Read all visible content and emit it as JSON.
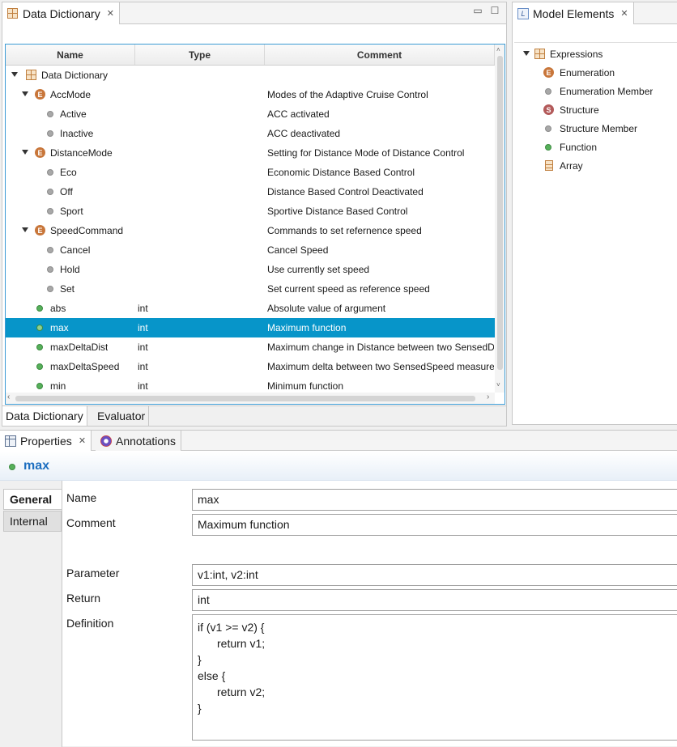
{
  "data_dictionary_view": {
    "tab_title": "Data Dictionary",
    "columns": [
      "Name",
      "Type",
      "Comment"
    ],
    "rows": [
      {
        "name": "Data Dictionary",
        "type": "",
        "comment": ""
      },
      {
        "name": "AccMode",
        "type": "",
        "comment": "Modes of the Adaptive Cruise Control"
      },
      {
        "name": "Active",
        "type": "",
        "comment": "ACC activated"
      },
      {
        "name": "Inactive",
        "type": "",
        "comment": "ACC deactivated"
      },
      {
        "name": "DistanceMode",
        "type": "",
        "comment": "Setting for Distance Mode of Distance Control"
      },
      {
        "name": "Eco",
        "type": "",
        "comment": "Economic Distance Based Control"
      },
      {
        "name": "Off",
        "type": "",
        "comment": "Distance Based Control Deactivated"
      },
      {
        "name": "Sport",
        "type": "",
        "comment": "Sportive Distance Based Control"
      },
      {
        "name": "SpeedCommand",
        "type": "",
        "comment": "Commands to set refernence speed"
      },
      {
        "name": "Cancel",
        "type": "",
        "comment": "Cancel Speed"
      },
      {
        "name": "Hold",
        "type": "",
        "comment": "Use currently set speed"
      },
      {
        "name": "Set",
        "type": "",
        "comment": "Set current speed as reference speed"
      },
      {
        "name": "abs",
        "type": "int",
        "comment": "Absolute value of argument"
      },
      {
        "name": "max",
        "type": "int",
        "comment": "Maximum function"
      },
      {
        "name": "maxDeltaDist",
        "type": "int",
        "comment": "Maximum change in Distance between two SensedDi..."
      },
      {
        "name": "maxDeltaSpeed",
        "type": "int",
        "comment": "Maximum delta between two SensedSpeed measure..."
      },
      {
        "name": "min",
        "type": "int",
        "comment": "Minimum function"
      }
    ],
    "bottom_tabs": [
      "Data Dictionary",
      "Evaluator"
    ]
  },
  "model_elements_view": {
    "tab_title": "Model Elements",
    "items": [
      {
        "label": "Expressions",
        "icon": "table-icon"
      },
      {
        "label": "Enumeration",
        "icon": "enumeration-icon"
      },
      {
        "label": "Enumeration Member",
        "icon": "member-icon"
      },
      {
        "label": "Structure",
        "icon": "structure-icon"
      },
      {
        "label": "Structure Member",
        "icon": "member-icon"
      },
      {
        "label": "Function",
        "icon": "function-icon"
      },
      {
        "label": "Array",
        "icon": "array-icon"
      }
    ]
  },
  "properties_view": {
    "tabs": [
      "Properties",
      "Annotations"
    ],
    "title": "max",
    "side_tabs": [
      "General",
      "Internal"
    ],
    "fields": {
      "name_label": "Name",
      "name_value": "max",
      "comment_label": "Comment",
      "comment_value": "Maximum function",
      "parameter_label": "Parameter",
      "parameter_value": "v1:int, v2:int",
      "return_label": "Return",
      "return_value": "int",
      "definition_label": "Definition",
      "definition_lines": [
        "if (v1 >= v2) {",
        "return v1;",
        "}",
        "else {",
        "return v2;",
        "}"
      ]
    }
  },
  "colors": {
    "selection": "#0795c9",
    "title": "#1e6fc0"
  }
}
